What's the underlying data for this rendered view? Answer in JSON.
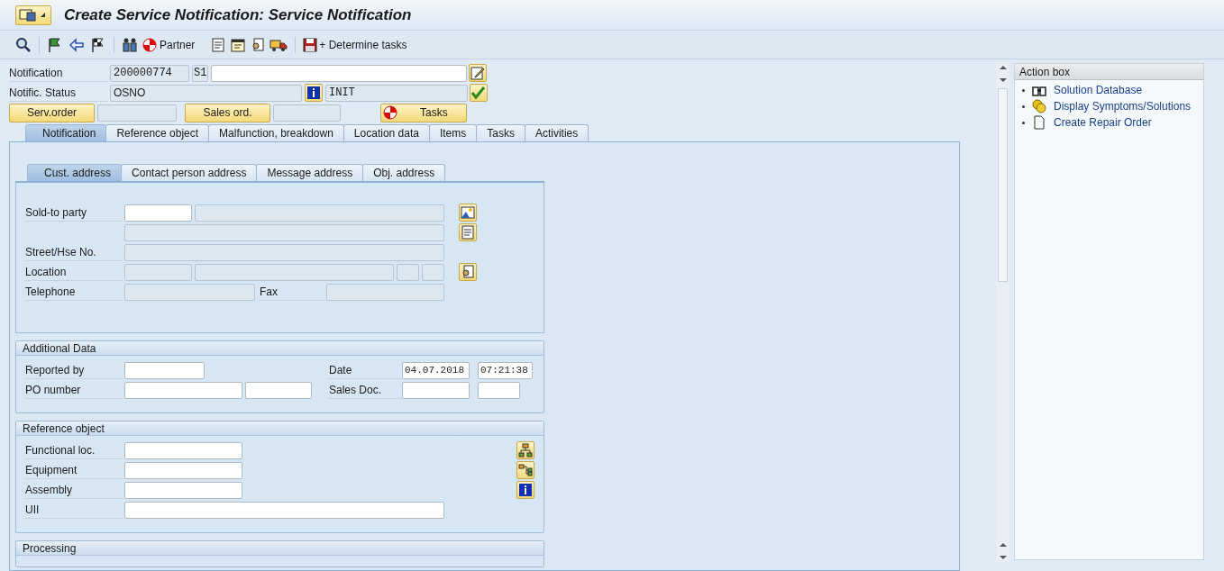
{
  "window": {
    "title": "Create Service Notification: Service Notification"
  },
  "toolbar": {
    "partner": "Partner",
    "determine_tasks": "+ Determine tasks"
  },
  "header": {
    "notification": {
      "label": "Notification",
      "number": "200000774",
      "type": "S1"
    },
    "status": {
      "label": "Notific. Status",
      "system_status": "OSNO",
      "user_status": "INIT"
    },
    "buttons": [
      "Serv.order",
      "Sales ord.",
      "Tasks"
    ]
  },
  "tabs": [
    {
      "label": "Notification",
      "selected": true
    },
    {
      "label": "Reference object",
      "selected": false
    },
    {
      "label": "Malfunction, breakdown",
      "selected": false
    },
    {
      "label": "Location data",
      "selected": false
    },
    {
      "label": "Items",
      "selected": false
    },
    {
      "label": "Tasks",
      "selected": false
    },
    {
      "label": "Activities",
      "selected": false
    }
  ],
  "subtabs": [
    {
      "label": "Cust. address",
      "selected": true
    },
    {
      "label": "Contact person address",
      "selected": false
    },
    {
      "label": "Message address",
      "selected": false
    },
    {
      "label": "Obj. address",
      "selected": false
    }
  ],
  "cust_address": [
    {
      "label": "Sold-to party",
      "fields": [
        {
          "kind": "input"
        },
        {
          "kind": "display"
        }
      ]
    },
    {
      "fields": [
        {
          "kind": "display"
        }
      ]
    },
    {
      "label": "Street/Hse No.",
      "fields": [
        {
          "kind": "display"
        }
      ]
    },
    {
      "label": "Location",
      "fields": [
        {
          "kind": "display"
        },
        {
          "kind": "display"
        },
        {
          "kind": "display"
        },
        {
          "kind": "display"
        }
      ]
    },
    {
      "label": "Telephone",
      "fields": [
        {
          "kind": "display"
        },
        {
          "kind": "label",
          "text": "Fax"
        },
        {
          "kind": "display"
        }
      ]
    }
  ],
  "additional_data": {
    "title": "Additional Data",
    "rows": [
      {
        "label": "Reported by",
        "fields": [
          {
            "kind": "input"
          },
          {
            "kind": "label",
            "text": "Date"
          },
          {
            "kind": "input",
            "value": "04.07.2018"
          },
          {
            "kind": "input",
            "value": "07:21:38"
          }
        ]
      },
      {
        "label": "PO number",
        "fields": [
          {
            "kind": "input"
          },
          {
            "kind": "input"
          },
          {
            "kind": "label",
            "text": "Sales Doc."
          },
          {
            "kind": "input"
          },
          {
            "kind": "input"
          }
        ]
      }
    ]
  },
  "reference_object": {
    "title": "Reference object",
    "rows": [
      {
        "label": "Functional loc.",
        "fields": [
          {
            "kind": "input"
          }
        ]
      },
      {
        "label": "Equipment",
        "fields": [
          {
            "kind": "input"
          }
        ]
      },
      {
        "label": "Assembly",
        "fields": [
          {
            "kind": "input"
          }
        ]
      },
      {
        "label": "UII",
        "fields": [
          {
            "kind": "input"
          }
        ]
      }
    ]
  },
  "processing": {
    "title": "Processing"
  },
  "action_box": {
    "title": "Action box",
    "items": [
      "Solution Database",
      "Display Symptoms/Solutions",
      "Create Repair Order"
    ]
  }
}
